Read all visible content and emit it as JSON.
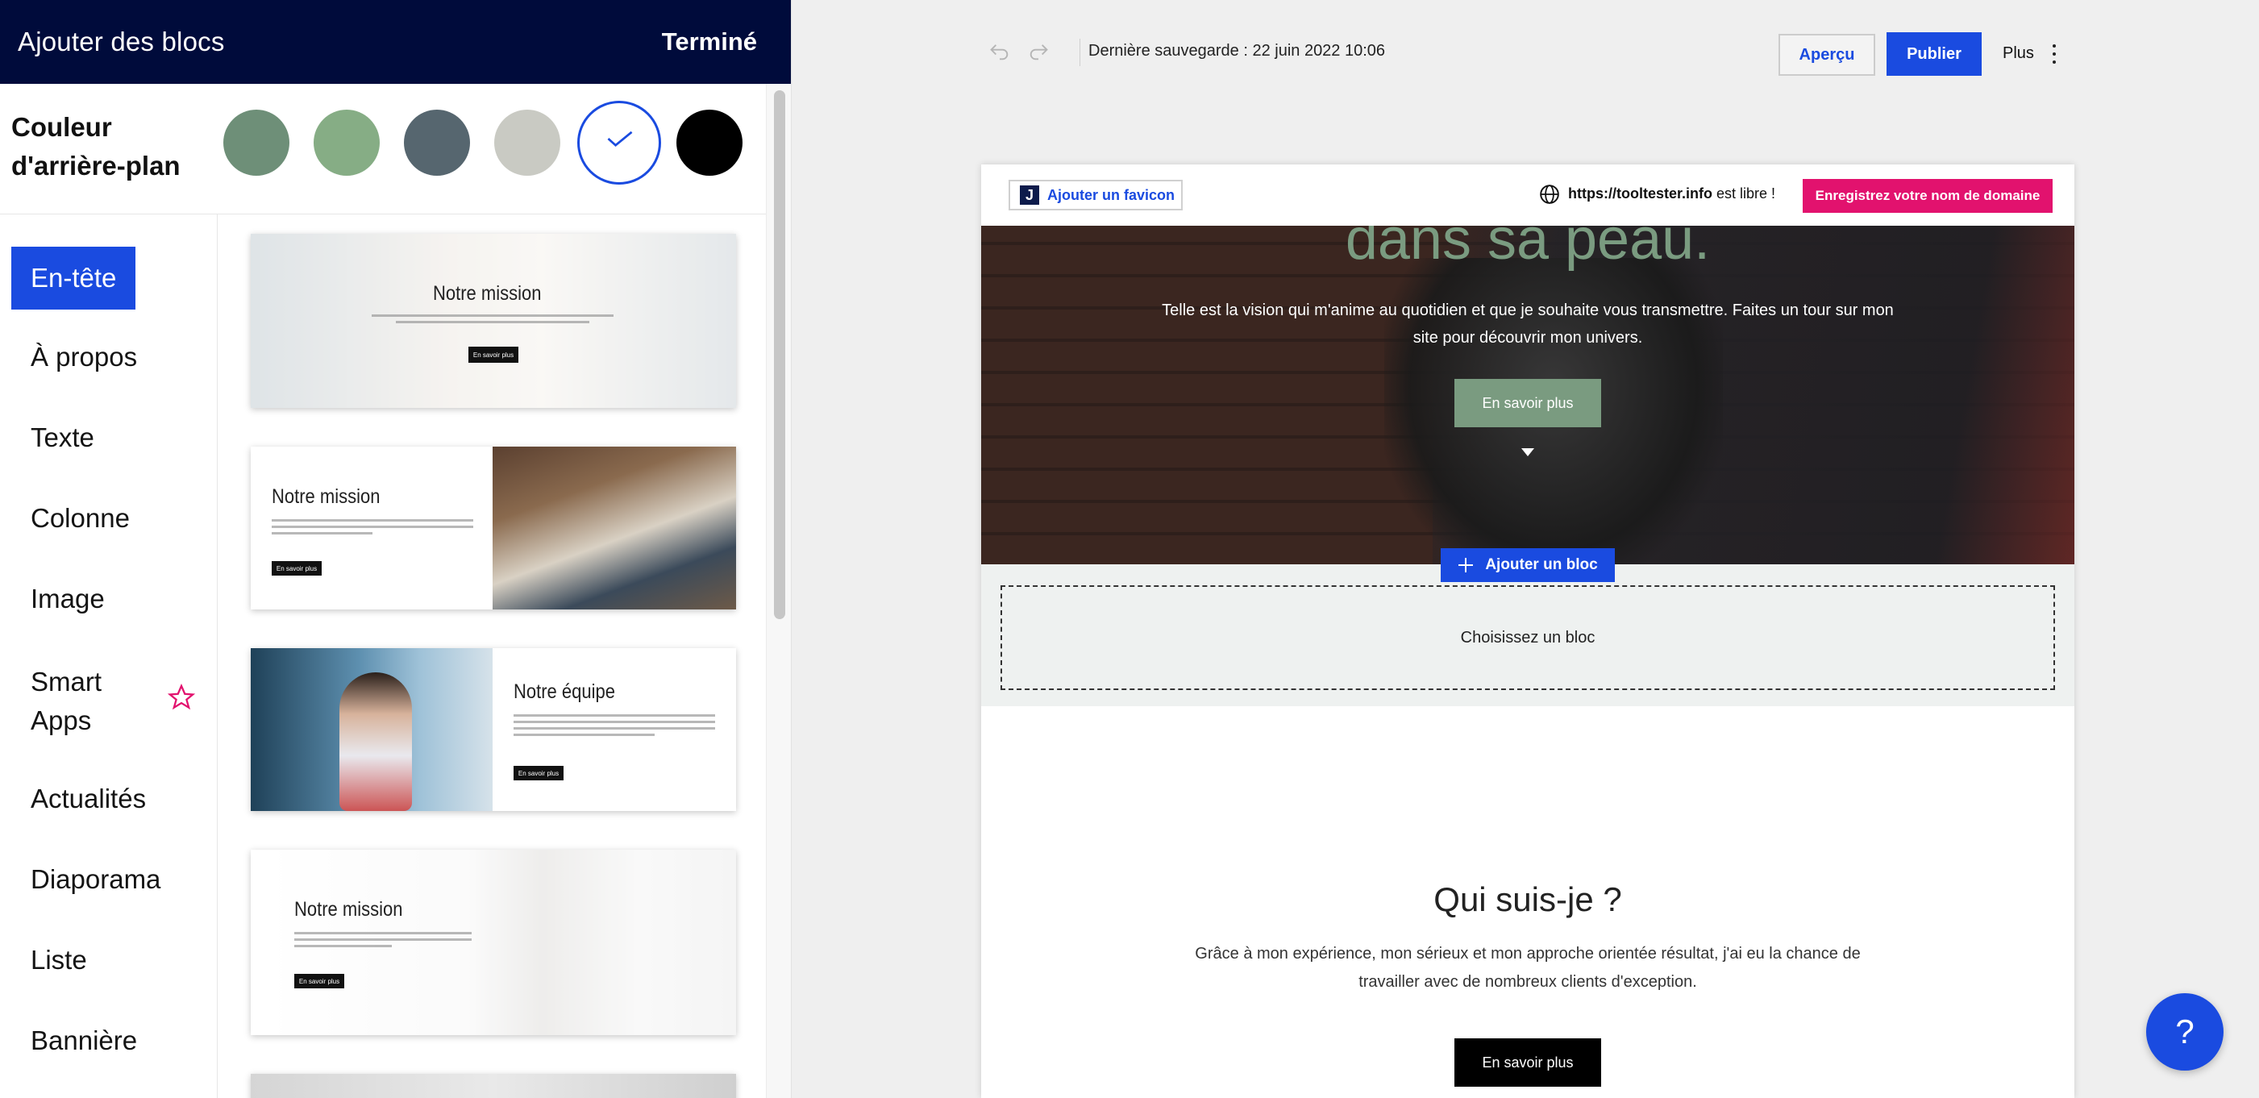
{
  "panel": {
    "title": "Ajouter des blocs",
    "done_label": "Terminé",
    "bg_color_label": "Couleur d'arrière-plan",
    "swatches": [
      "#6e8f78",
      "#86ad85",
      "#56666f",
      "#c9cac3",
      "#ffffff",
      "#000000"
    ],
    "categories": [
      "En-tête",
      "À propos",
      "Texte",
      "Colonne",
      "Image",
      "Smart Apps",
      "Actualités",
      "Diaporama",
      "Liste",
      "Bannière"
    ]
  },
  "templates": [
    {
      "title": "Notre mission",
      "button": "En savoir plus"
    },
    {
      "title": "Notre mission",
      "button": "En savoir plus"
    },
    {
      "title": "Notre équipe",
      "button": "En savoir plus"
    },
    {
      "title": "Notre mission",
      "button": "En savoir plus"
    }
  ],
  "topbar": {
    "save_status": "Dernière sauvegarde : 22 juin 2022 10:06",
    "preview_label": "Aperçu",
    "publish_label": "Publier",
    "more_label": "Plus"
  },
  "site": {
    "favicon_label": "Ajouter un favicon",
    "favicon_letter": "J",
    "domain_name": "https://tooltester.info",
    "domain_suffix": " est libre !",
    "register_label": "Enregistrez votre nom de domaine",
    "hero_title": "dans sa peau.",
    "hero_text": "Telle est la vision qui m'anime au quotidien et que je souhaite vous transmettre. Faites un tour sur mon site pour découvrir mon univers.",
    "hero_button": "En savoir plus",
    "add_block_label": "Ajouter un bloc",
    "choose_block_label": "Choisissez un bloc",
    "about_title": "Qui suis-je ?",
    "about_text": "Grâce à mon expérience, mon sérieux et mon approche orientée résultat, j'ai eu la chance de travailler avec de nombreux clients d'exception.",
    "about_button": "En savoir plus"
  },
  "help_label": "?",
  "colors": {
    "accent": "#1a4be0",
    "panel_header": "#000b3b",
    "brand_pink": "#e2126e",
    "sage": "#7a9b80"
  }
}
